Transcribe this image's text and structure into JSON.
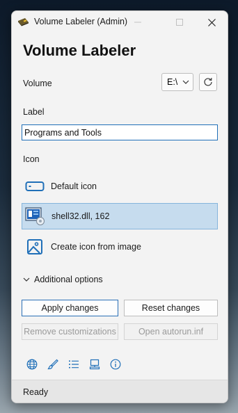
{
  "window": {
    "title": "Volume Labeler (Admin)",
    "icons": {
      "app": "drive-icon",
      "minimize": "minimize-icon",
      "maximize": "maximize-icon",
      "close": "close-icon"
    }
  },
  "header": {
    "title": "Volume Labeler"
  },
  "volume": {
    "label": "Volume",
    "selected": "E:\\",
    "refresh_icon": "refresh-icon"
  },
  "label_field": {
    "label": "Label",
    "value": "Programs and Tools"
  },
  "icon_section": {
    "label": "Icon",
    "options": [
      {
        "label": "Default icon",
        "icon": "drive-icon",
        "selected": false
      },
      {
        "label": "shell32.dll, 162",
        "icon": "shell32-icon",
        "selected": true
      },
      {
        "label": "Create icon from image",
        "icon": "image-icon",
        "selected": false
      }
    ]
  },
  "additional_options": {
    "label": "Additional options",
    "expanded": true
  },
  "buttons": {
    "apply": "Apply changes",
    "reset": "Reset changes",
    "remove": "Remove customizations",
    "open_autorun": "Open autorun.inf"
  },
  "toolbar": [
    "globe-icon",
    "brush-icon",
    "list-icon",
    "computer-icon",
    "info-icon"
  ],
  "status": {
    "text": "Ready"
  },
  "colors": {
    "accent": "#1f6fb8",
    "selected_bg": "#c6dcee"
  }
}
